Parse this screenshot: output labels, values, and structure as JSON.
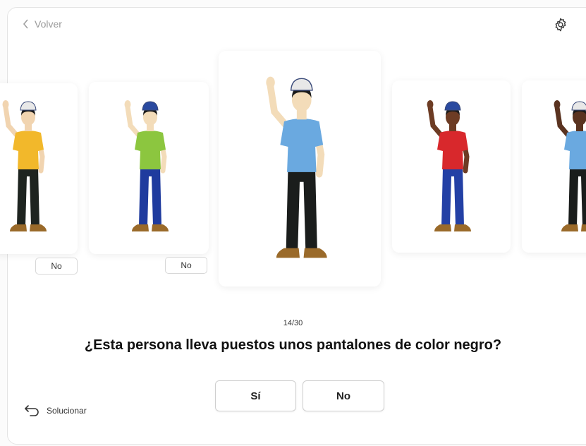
{
  "header": {
    "back_label": "Volver"
  },
  "icons": {
    "back": "chevron-left-icon",
    "settings": "gear-icon",
    "solve": "undo-arrow-icon"
  },
  "cards": [
    {
      "shirt": "#f2b82b",
      "pants": "#1e2420",
      "skin": "#f1d4b0",
      "cap": "#e8e8e8",
      "label": "No"
    },
    {
      "shirt": "#8cc63f",
      "pants": "#1f3b9e",
      "skin": "#f3dcb9",
      "cap": "#2a4aa0",
      "label": "No"
    },
    {
      "shirt": "#6aa9e0",
      "pants": "#1a1d1c",
      "skin": "#f3dcb9",
      "cap": "#e8e8e8",
      "label": ""
    },
    {
      "shirt": "#d8282c",
      "pants": "#2340a5",
      "skin": "#6d3c24",
      "cap": "#2a4aa0",
      "label": ""
    },
    {
      "shirt": "#6aa9e0",
      "pants": "#1a1d1c",
      "skin": "#5a3320",
      "cap": "#e8e8e8",
      "label": ""
    }
  ],
  "progress": {
    "text": "14/30"
  },
  "question": "¿Esta persona lleva puestos unos pantalones de color negro?",
  "answers": {
    "yes": "Sí",
    "no": "No"
  },
  "footer": {
    "solve_label": "Solucionar"
  }
}
